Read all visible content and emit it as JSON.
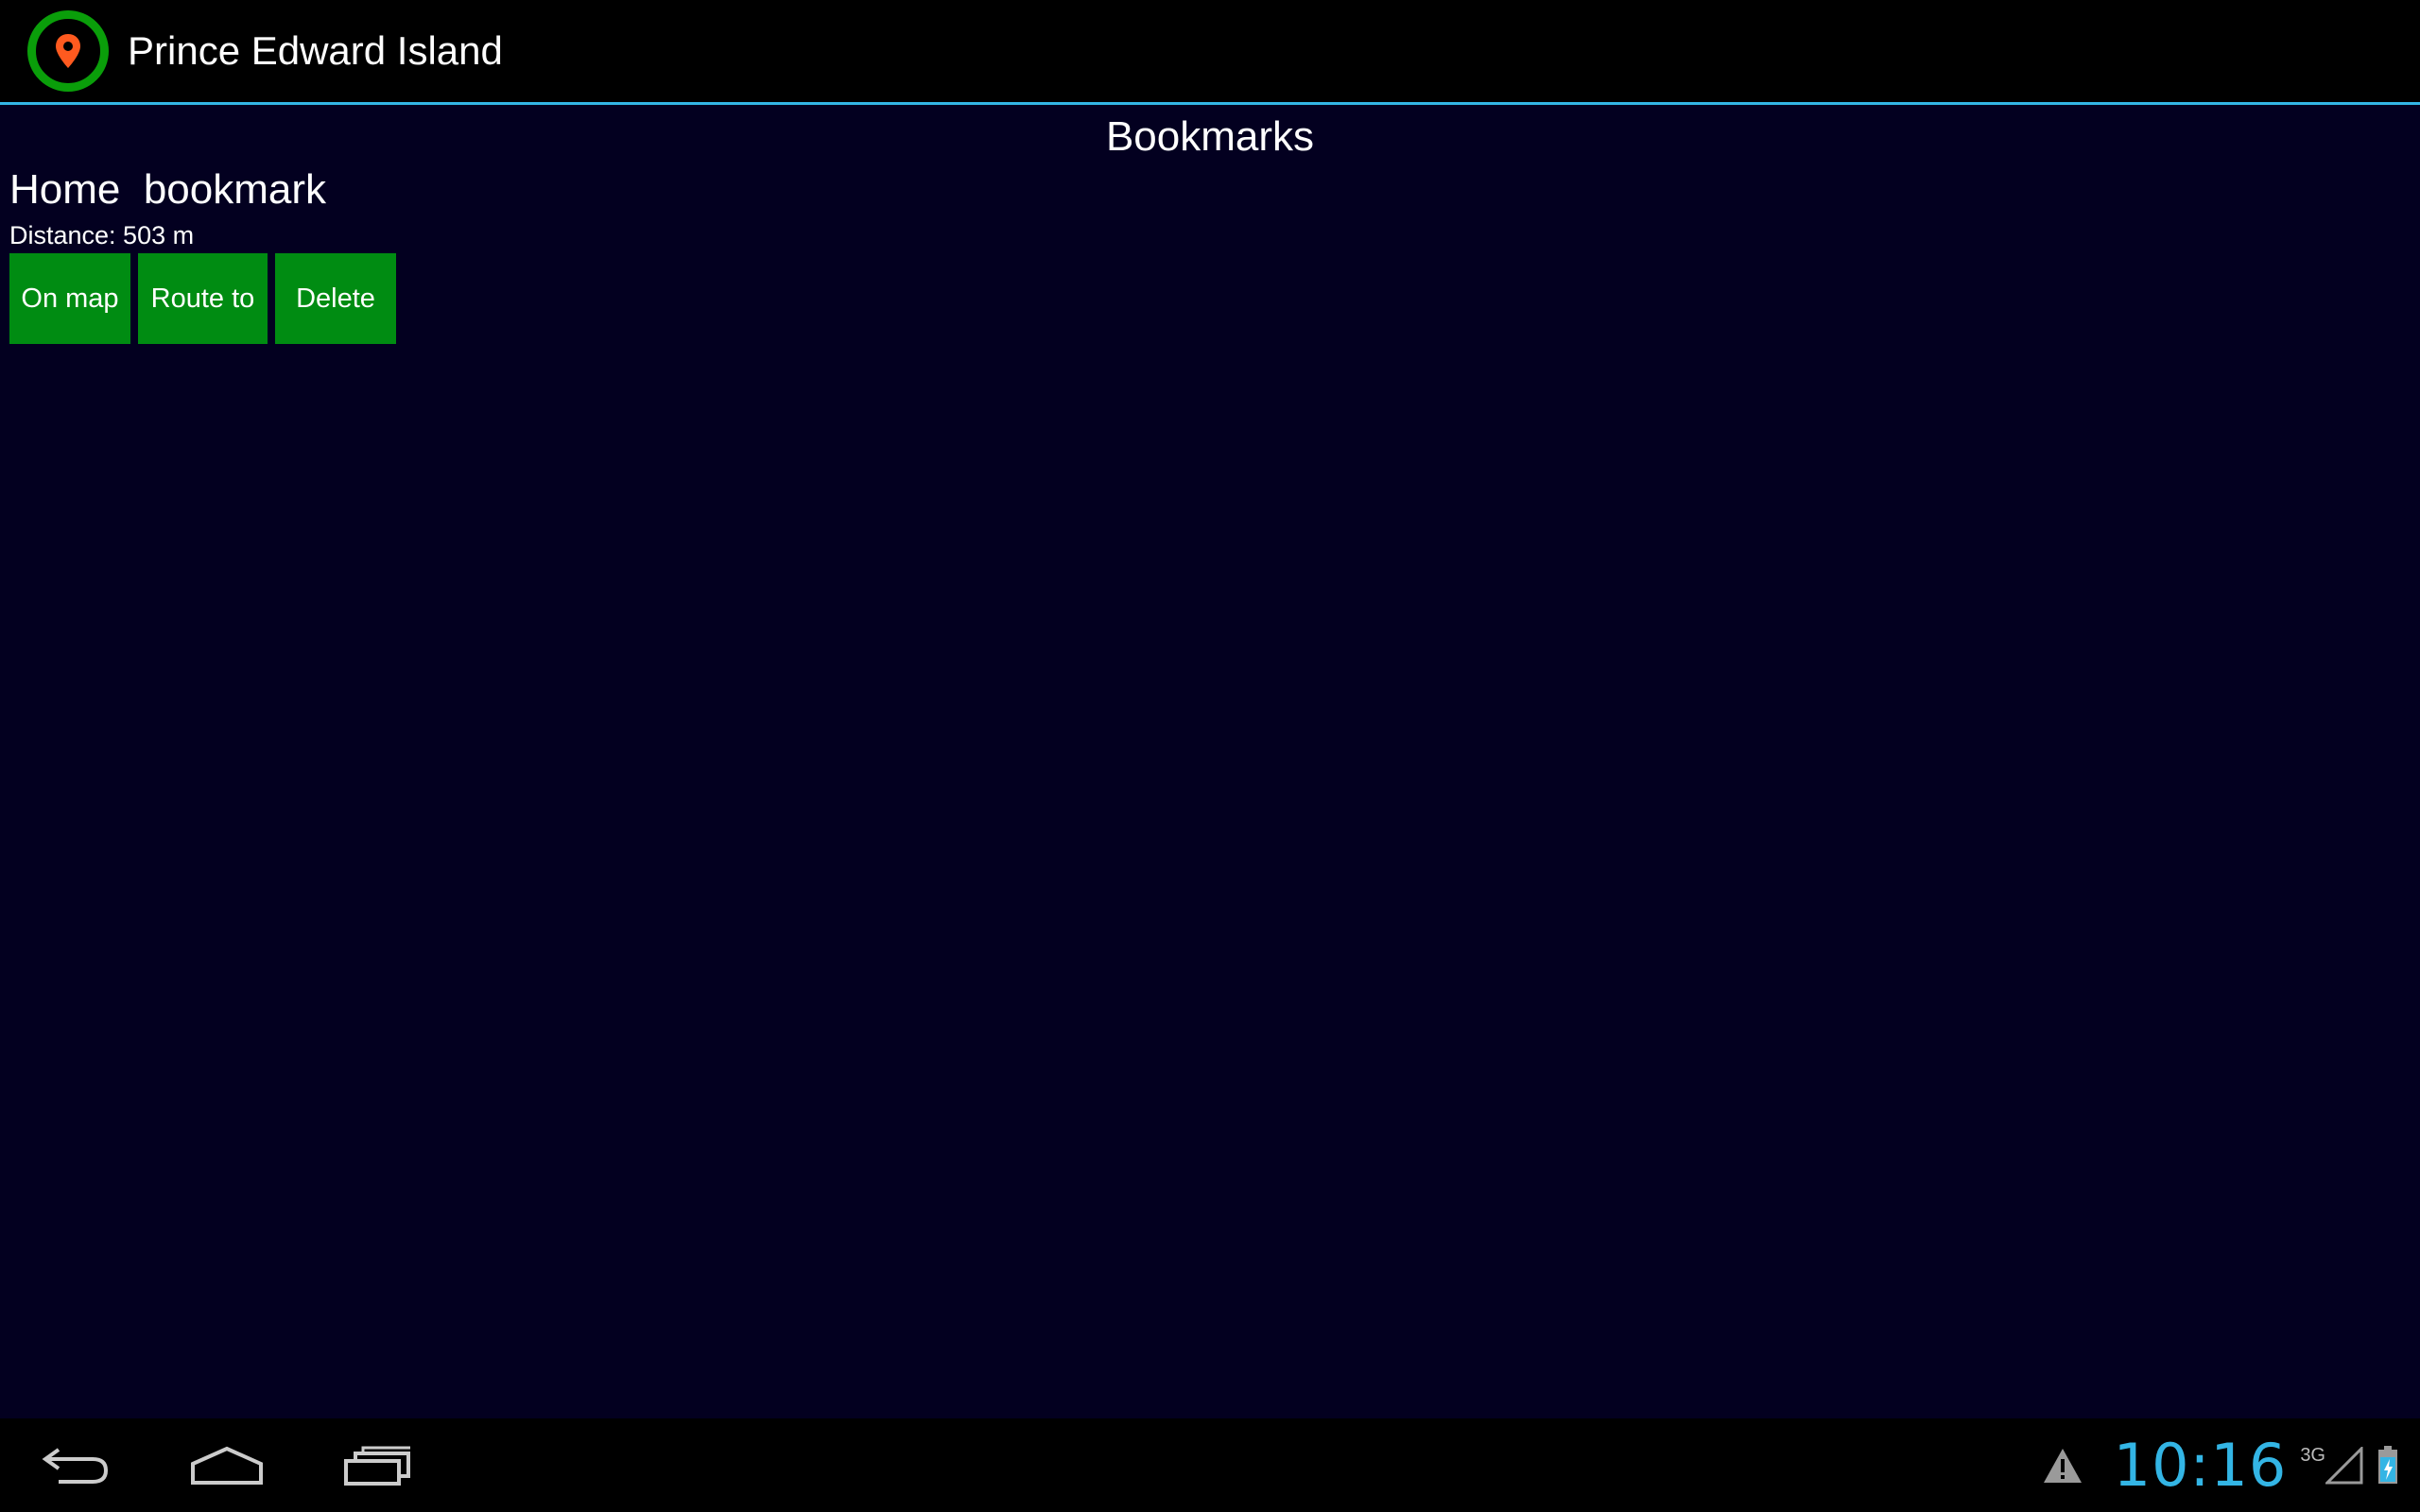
{
  "action_bar": {
    "title": "Prince Edward Island",
    "accent_color": "#33b5e5",
    "icon": "map-pin-icon"
  },
  "content": {
    "heading": "Bookmarks",
    "bookmarks": [
      {
        "name": "Home  bookmark",
        "distance": "Distance: 503 m",
        "actions": {
          "on_map": "On map",
          "route_to": "Route to",
          "delete": "Delete"
        }
      }
    ],
    "button_color": "#008c12",
    "background_color": "#030020"
  },
  "nav_bar": {
    "back": "back-icon",
    "home": "home-icon",
    "recents": "recents-icon"
  },
  "status": {
    "clock": "10:16",
    "network_type": "3G",
    "clock_color": "#33b5e5"
  }
}
